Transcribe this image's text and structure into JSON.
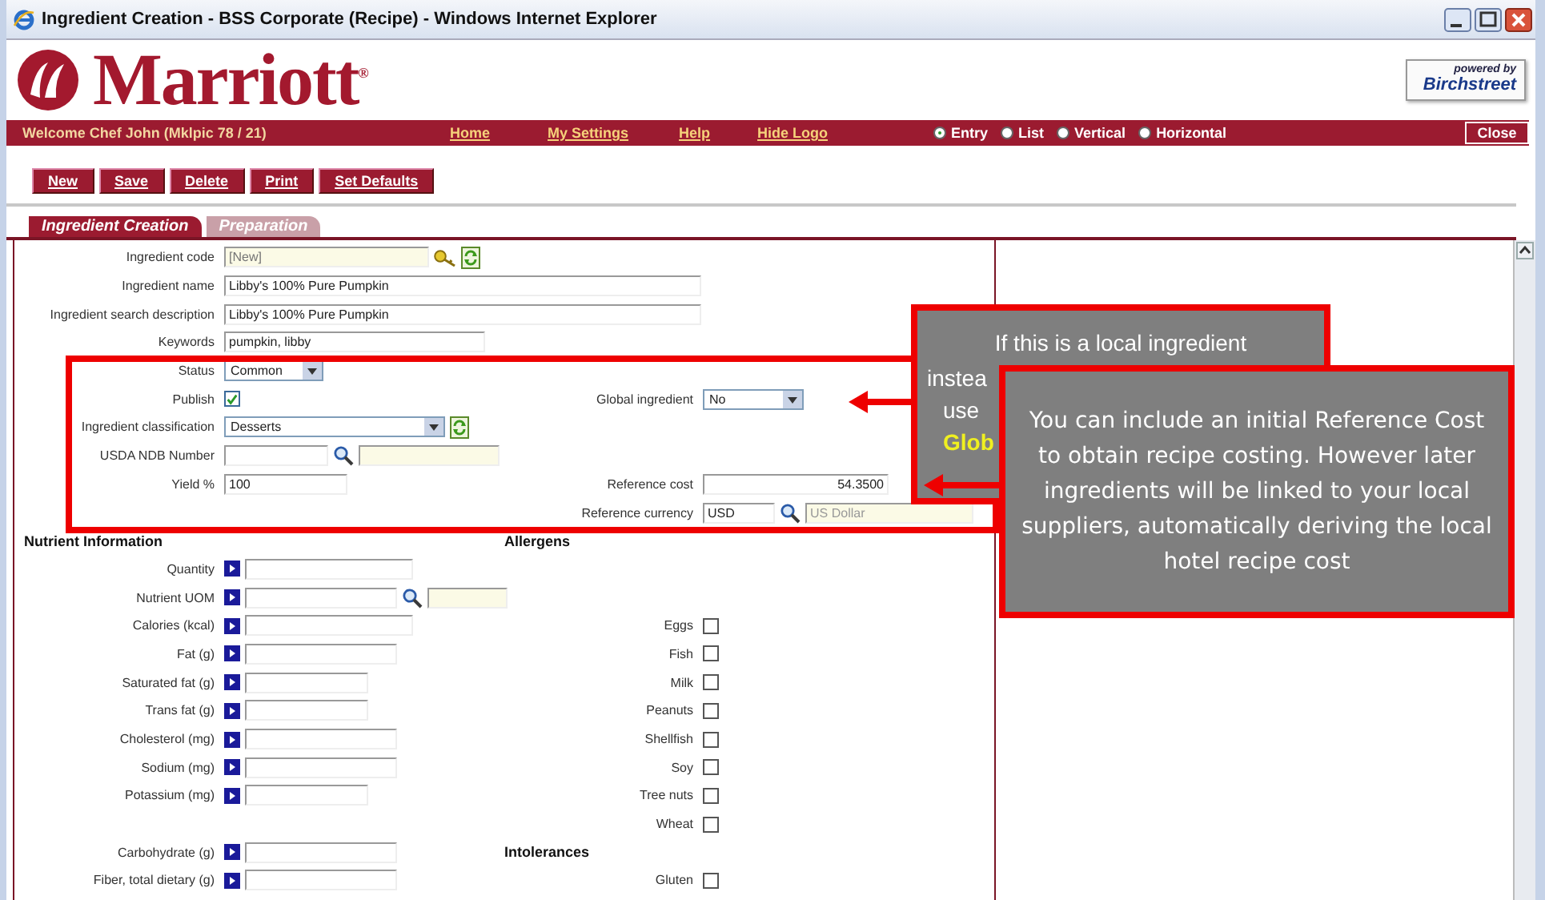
{
  "window": {
    "title": "Ingredient Creation - BSS Corporate (Recipe) - Windows Internet Explorer"
  },
  "header": {
    "logo": "Marriott$^{®}$",
    "badge_caption": "powered by",
    "badge_brand": "Birchstreet"
  },
  "nav": {
    "welcome": "Welcome Chef John (Mklpic 78 / 21)",
    "links": [
      "Home",
      "My Settings",
      "Help",
      "Hide Logo"
    ],
    "views": [
      {
        "label": "Entry",
        "selected": true
      },
      {
        "label": "List",
        "selected": false
      },
      {
        "label": "Vertical",
        "selected": false
      },
      {
        "label": "Horizontal",
        "selected": false
      }
    ],
    "close": "Close"
  },
  "toolbar": [
    "New",
    "Save",
    "Delete",
    "Print",
    "Set Defaults"
  ],
  "tabs": [
    {
      "label": "Ingredient Creation",
      "selected": true
    },
    {
      "label": "Preparation",
      "selected": false
    }
  ],
  "form": [
    {
      "left": {
        "kind": "code",
        "label": "Ingredient code",
        "placeholder": "[New]"
      }
    },
    {
      "left": {
        "kind": "text",
        "label": "Ingredient name",
        "value": "Libby's 100% Pure Pumpkin"
      }
    },
    {
      "left": {
        "kind": "text",
        "label": "Ingredient search description",
        "value": "Libby's 100% Pure Pumpkin"
      }
    },
    {
      "left": {
        "kind": "text",
        "label": "Keywords",
        "value": "pumpkin, libby"
      }
    },
    {
      "left": {
        "kind": "select",
        "label": "Status",
        "value": "Common"
      }
    },
    {
      "left": {
        "kind": "checkbox",
        "label": "Publish",
        "checked": true
      },
      "right": {
        "kind": "select",
        "label": "Global ingredient",
        "value": "No"
      }
    },
    {
      "left": {
        "kind": "select-refresh",
        "label": "Ingredient classification",
        "value": "Desserts"
      }
    },
    {
      "left": {
        "kind": "lookup",
        "label": "USDA NDB Number"
      }
    },
    {
      "left": {
        "kind": "text",
        "label": "Yield %",
        "value": "100"
      },
      "right": {
        "kind": "amount",
        "label": "Reference cost",
        "value": "54.3500"
      }
    },
    {
      "right": {
        "kind": "lookup",
        "label": "Reference currency",
        "value": "USD",
        "description": "US Dollar"
      }
    },
    {
      "left": {
        "kind": "heading",
        "label": "Nutrient Information"
      },
      "right": {
        "kind": "heading",
        "label": "Allergens"
      }
    },
    {
      "left": {
        "kind": "nutrient",
        "label": "Quantity"
      }
    },
    {
      "left": {
        "kind": "nutrient-lookup",
        "label": "Nutrient UOM"
      }
    },
    {
      "left": {
        "kind": "nutrient",
        "label": "Calories (kcal)"
      },
      "right": {
        "kind": "checkbox",
        "label": "Eggs",
        "checked": false
      }
    },
    {
      "left": {
        "kind": "nutrient",
        "label": "Fat (g)"
      },
      "right": {
        "kind": "checkbox",
        "label": "Fish",
        "checked": false
      }
    },
    {
      "left": {
        "kind": "nutrient",
        "label": "Saturated fat (g)"
      },
      "right": {
        "kind": "checkbox",
        "label": "Milk",
        "checked": false
      }
    },
    {
      "left": {
        "kind": "nutrient",
        "label": "Trans fat (g)"
      },
      "right": {
        "kind": "checkbox",
        "label": "Peanuts",
        "checked": false
      }
    },
    {
      "left": {
        "kind": "nutrient",
        "label": "Cholesterol (mg)"
      },
      "right": {
        "kind": "checkbox",
        "label": "Shellfish",
        "checked": false
      }
    },
    {
      "left": {
        "kind": "nutrient",
        "label": "Sodium (mg)"
      },
      "right": {
        "kind": "checkbox",
        "label": "Soy",
        "checked": false
      }
    },
    {
      "left": {
        "kind": "nutrient",
        "label": "Potassium (mg)"
      },
      "right": {
        "kind": "checkbox",
        "label": "Tree nuts",
        "checked": false
      }
    },
    {
      "right": {
        "kind": "checkbox",
        "label": "Wheat",
        "checked": false
      }
    },
    {
      "left": {
        "kind": "nutrient",
        "label": "Carbohydrate (g)"
      },
      "right": {
        "kind": "heading",
        "label": "Intolerances"
      }
    },
    {
      "left": {
        "kind": "nutrient",
        "label": "Fiber, total dietary (g)"
      },
      "right": {
        "kind": "checkbox",
        "label": "Gluten",
        "checked": false
      }
    }
  ],
  "callouts": [
    {
      "lines": [
        {
          "text": "If this is a local ingredient",
          "highlight": false
        },
        {
          "text": "instea",
          "highlight": false
        },
        {
          "text": "use",
          "highlight": false
        },
        {
          "text": "Glob",
          "highlight": true
        }
      ]
    },
    {
      "text": "You can include an initial Reference Cost to obtain recipe costing. However later ingredients will be linked to your local suppliers, automatically deriving the local hotel recipe cost"
    }
  ]
}
